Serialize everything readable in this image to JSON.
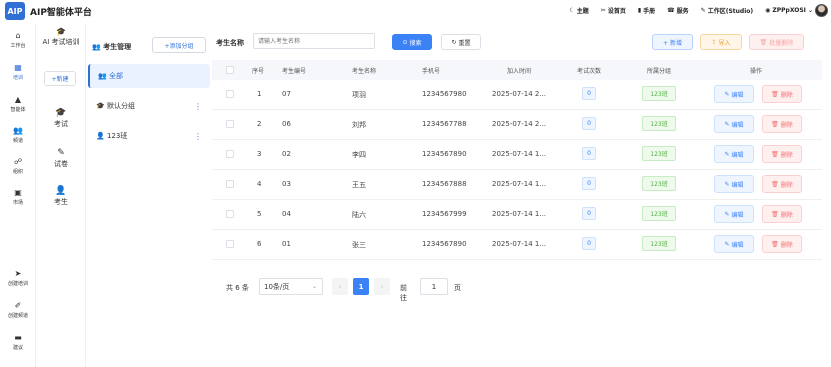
{
  "app": {
    "logo": "AIP",
    "title": "AIP智能体平台"
  },
  "topnav": [
    {
      "icon": "moon-icon",
      "glyph": "☾",
      "label": "主题"
    },
    {
      "icon": "tools-icon",
      "glyph": "✂",
      "label": "设首页"
    },
    {
      "icon": "book-icon",
      "glyph": "▮",
      "label": "手册"
    },
    {
      "icon": "phone-icon",
      "glyph": "☎",
      "label": "服务"
    },
    {
      "icon": "pen-icon",
      "glyph": "✎",
      "label": "工作区(Studio)"
    },
    {
      "icon": "user-shield-icon",
      "glyph": "◉",
      "label": "ZPPpXOSI ⌄"
    }
  ],
  "rail": [
    {
      "name": "rail-workbench",
      "icon": "home-icon",
      "glyph": "⌂",
      "label": "工作台",
      "active": false
    },
    {
      "name": "rail-training",
      "icon": "calendar-icon",
      "glyph": "▦",
      "label": "培训",
      "active": true
    },
    {
      "name": "rail-agent",
      "icon": "warning-icon",
      "glyph": "▲",
      "label": "智能体",
      "active": false
    },
    {
      "name": "rail-channel",
      "icon": "users-icon",
      "glyph": "👥",
      "label": "频道",
      "active": false
    },
    {
      "name": "rail-org",
      "icon": "org-icon",
      "glyph": "☍",
      "label": "组织",
      "active": false
    },
    {
      "name": "rail-market",
      "icon": "market-icon",
      "glyph": "▣",
      "label": "市场",
      "active": false
    },
    {
      "name": "rail-create-training",
      "icon": "send-icon",
      "glyph": "➤",
      "label": "创建培训",
      "active": false
    },
    {
      "name": "rail-create-channel",
      "icon": "brush-icon",
      "glyph": "✐",
      "label": "创建频道",
      "active": false
    },
    {
      "name": "rail-suggest",
      "icon": "comment-icon",
      "glyph": "▬",
      "label": "建议",
      "active": false
    }
  ],
  "col2": {
    "head": "AI 考试培训",
    "new_label": "+新建",
    "items": [
      {
        "icon": "exam-icon",
        "glyph": "🎓",
        "label": "考试"
      },
      {
        "icon": "paper-icon",
        "glyph": "✎",
        "label": "试卷"
      },
      {
        "icon": "student-icon",
        "glyph": "👤",
        "label": "考生"
      }
    ]
  },
  "groups": {
    "title": "考生管理",
    "add_label": "+添加分组",
    "items": [
      {
        "glyph": "👥",
        "label": "全部",
        "active": true,
        "more": ""
      },
      {
        "glyph": "🎓",
        "label": "默认分组",
        "active": false,
        "more": "⋮"
      },
      {
        "glyph": "👤",
        "label": "123班",
        "active": false,
        "more": "⋮"
      }
    ]
  },
  "filter": {
    "label": "考生名称",
    "placeholder": "请输入考生名称",
    "search_label": "搜索",
    "reset_label": "重置",
    "add_label": "+ 新增",
    "import_label": "导入",
    "batch_delete_label": "批量删除"
  },
  "table": {
    "headers": [
      "序号",
      "考生编号",
      "考生名称",
      "手机号",
      "加入时间",
      "考试次数",
      "所属分组",
      "操作"
    ],
    "rows": [
      {
        "no": "1",
        "code": "07",
        "name": "项羽",
        "phone": "1234567980",
        "time": "2025-07-14 2...",
        "count": "0",
        "group": "123班"
      },
      {
        "no": "2",
        "code": "06",
        "name": "刘邦",
        "phone": "1234567788",
        "time": "2025-07-14 2...",
        "count": "0",
        "group": "123班"
      },
      {
        "no": "3",
        "code": "02",
        "name": "李四",
        "phone": "1234567890",
        "time": "2025-07-14 1...",
        "count": "0",
        "group": "123班"
      },
      {
        "no": "4",
        "code": "03",
        "name": "王五",
        "phone": "1234567888",
        "time": "2025-07-14 1...",
        "count": "0",
        "group": "123班"
      },
      {
        "no": "5",
        "code": "04",
        "name": "陆六",
        "phone": "1234567999",
        "time": "2025-07-14 1...",
        "count": "0",
        "group": "123班"
      },
      {
        "no": "6",
        "code": "01",
        "name": "张三",
        "phone": "1234567890",
        "time": "2025-07-14 1...",
        "count": "0",
        "group": "123班"
      }
    ],
    "edit_label": "编辑",
    "delete_label": "删除"
  },
  "pager": {
    "total": "共 6 条",
    "page_size": "10条/页",
    "current": "1",
    "goto_label": "前往",
    "goto_value": "1",
    "page_suffix": "页"
  },
  "colors": {
    "primary": "#3b82f6",
    "success": "#52b043",
    "danger": "#f56c6c",
    "warning": "#e6a23c"
  }
}
